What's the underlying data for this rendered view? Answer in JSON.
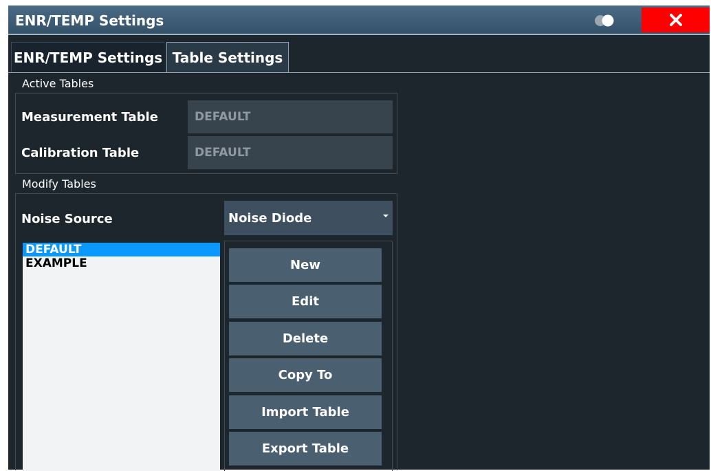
{
  "window": {
    "title": "ENR/TEMP Settings",
    "close_icon": "close-icon",
    "toggle_icon": "display-toggle-icon"
  },
  "tabs": [
    {
      "label": "ENR/TEMP Settings",
      "active": false
    },
    {
      "label": "Table Settings",
      "active": true
    }
  ],
  "active_tables": {
    "section_label": "Active Tables",
    "measurement_label": "Measurement Table",
    "measurement_value": "DEFAULT",
    "calibration_label": "Calibration Table",
    "calibration_value": "DEFAULT"
  },
  "modify_tables": {
    "section_label": "Modify Tables",
    "noise_source_label": "Noise Source",
    "noise_source_value": "Noise Diode",
    "tables": [
      {
        "name": "DEFAULT",
        "selected": true
      },
      {
        "name": "EXAMPLE",
        "selected": false
      }
    ],
    "buttons": {
      "new": "New",
      "edit": "Edit",
      "delete": "Delete",
      "copy_to": "Copy To",
      "import_table": "Import Table",
      "export_table": "Export Table"
    }
  },
  "colors": {
    "background": "#1e262d",
    "titlebar": "#3f5d77",
    "close": "#ff0000",
    "selected_row": "#0b99ff",
    "button": "#4a6070"
  }
}
